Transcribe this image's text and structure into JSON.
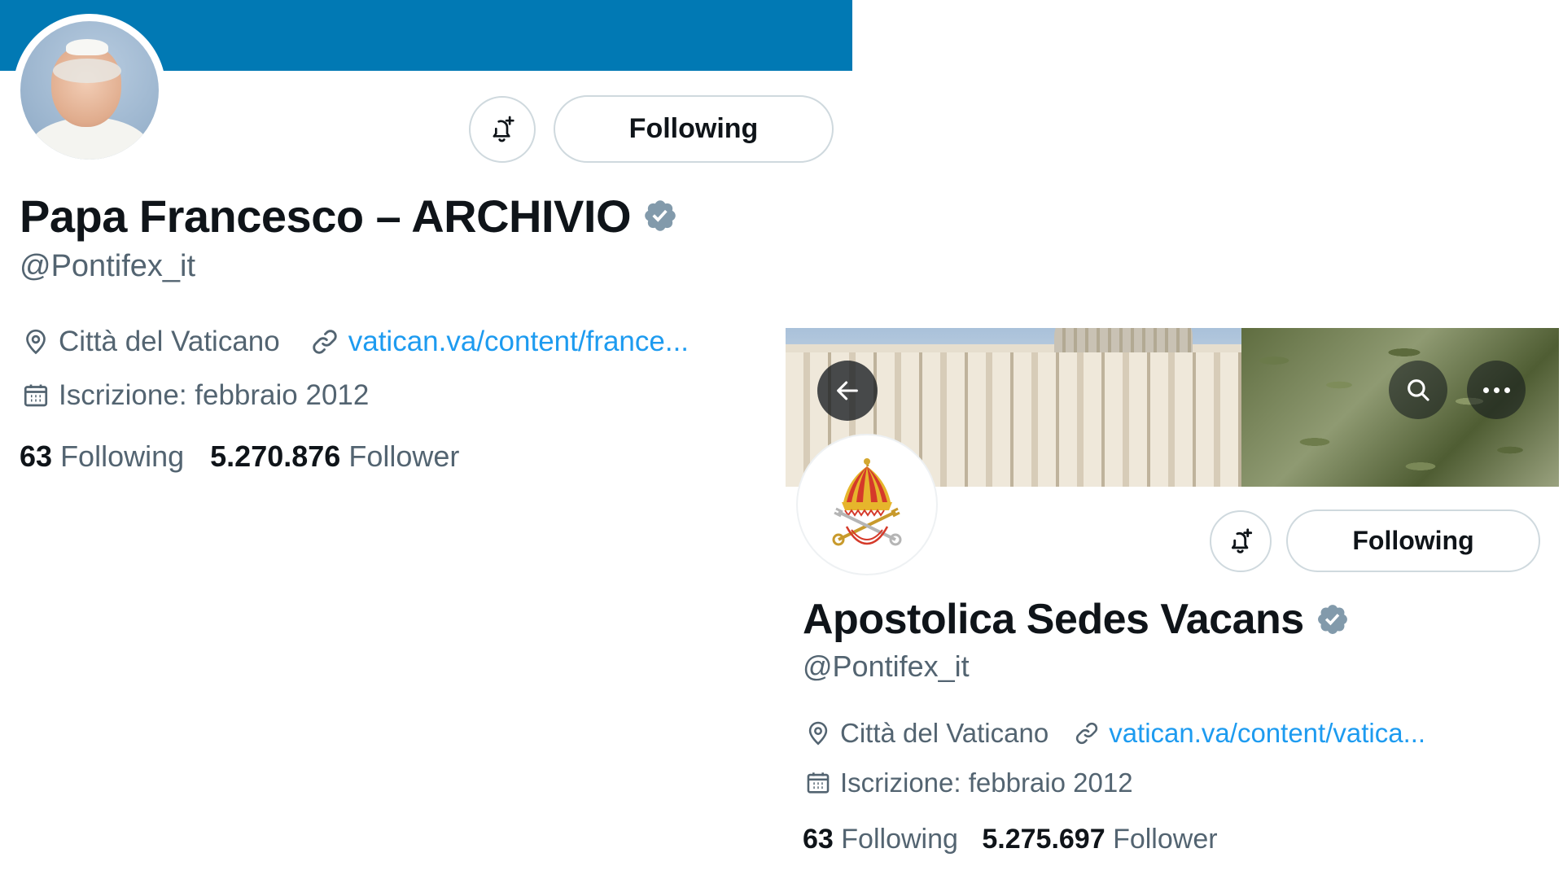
{
  "profiles": [
    {
      "display_name": "Papa Francesco – ARCHIVIO",
      "handle": "@Pontifex_it",
      "follow_label": "Following",
      "location": "Città del Vaticano",
      "website": "vatican.va/content/france...",
      "joined": "Iscrizione: febbraio 2012",
      "following_count": "63",
      "following_label": "Following",
      "followers_count": "5.270.876",
      "followers_label": "Follower",
      "banner_color": "#0179b4"
    },
    {
      "display_name": "Apostolica Sedes Vacans",
      "handle": "@Pontifex_it",
      "follow_label": "Following",
      "location": "Città del Vaticano",
      "website": "vatican.va/content/vatica...",
      "joined": "Iscrizione: febbraio 2012",
      "following_count": "63",
      "following_label": "Following",
      "followers_count": "5.275.697",
      "followers_label": "Follower"
    }
  ],
  "colors": {
    "verified_badge": "#829aab",
    "link": "#1d9bf0",
    "secondary_text": "#536471"
  }
}
